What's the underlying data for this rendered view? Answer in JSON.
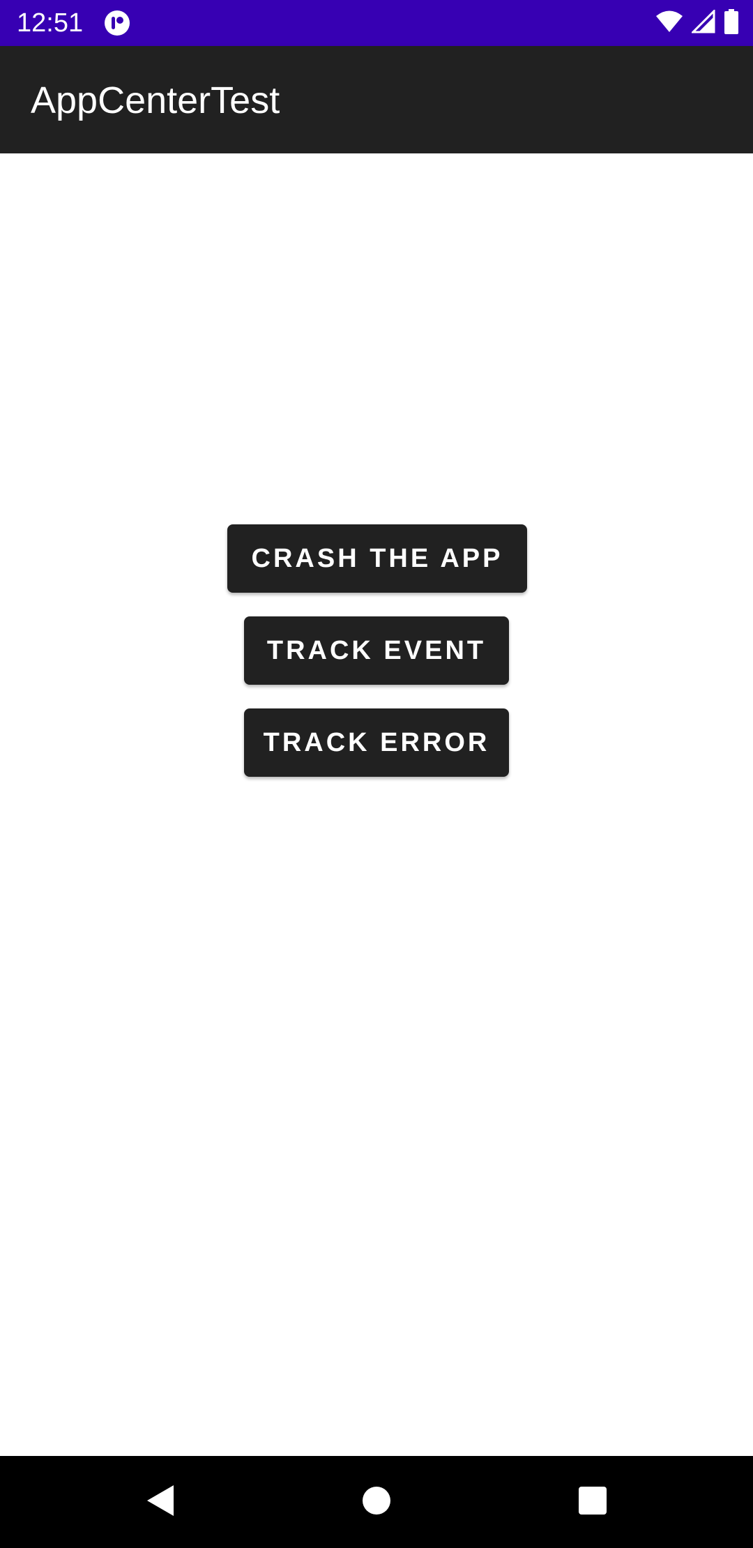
{
  "status_bar": {
    "time": "12:51",
    "background": "#3700B3",
    "icons": [
      "notification-icon",
      "wifi-icon",
      "cellular-signal-icon",
      "battery-icon"
    ]
  },
  "app_bar": {
    "title": "AppCenterTest",
    "background": "#212121"
  },
  "buttons": {
    "crash_label": "CRASH THE APP",
    "track_event_label": "TRACK EVENT",
    "track_error_label": "TRACK ERROR",
    "background": "#212121"
  },
  "nav_bar": {
    "icons": [
      "back-icon",
      "home-icon",
      "recents-icon"
    ]
  }
}
